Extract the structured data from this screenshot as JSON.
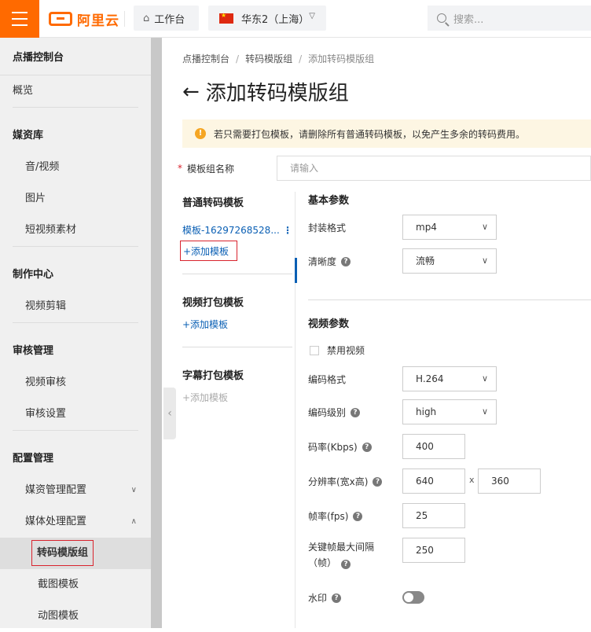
{
  "topbar": {
    "brand": "阿里云",
    "workspace": "工作台",
    "region": "华东2（上海）",
    "search_placeholder": "搜索..."
  },
  "sidebar": {
    "title": "点播控制台",
    "overview": "概览",
    "groups": [
      {
        "head": "媒资库",
        "items": [
          "音/视频",
          "图片",
          "短视频素材"
        ]
      },
      {
        "head": "制作中心",
        "items": [
          "视频剪辑"
        ]
      },
      {
        "head": "审核管理",
        "items": [
          "视频审核",
          "审核设置"
        ]
      },
      {
        "head": "配置管理",
        "items": [
          "媒资管理配置",
          "媒体处理配置",
          "转码模版组",
          "截图模板",
          "动图模板"
        ]
      }
    ]
  },
  "breadcrumb": [
    "点播控制台",
    "转码模版组",
    "添加转码模版组"
  ],
  "page_title": "添加转码模版组",
  "notice": "若只需要打包模板，请删除所有普通转码模板，以免产生多余的转码费用。",
  "form": {
    "name_label": "模板组名称",
    "name_placeholder": "请输入"
  },
  "templates": {
    "normal_title": "普通转码模板",
    "normal_item": "模板-16297268528...",
    "add_label": "+添加模板",
    "video_pack_title": "视频打包模板",
    "subtitle_pack_title": "字幕打包模板"
  },
  "basic": {
    "title": "基本参数",
    "container_label": "封装格式",
    "container_value": "mp4",
    "definition_label": "清晰度",
    "definition_value": "流畅"
  },
  "video": {
    "title": "视频参数",
    "disable_label": "禁用视频",
    "codec_label": "编码格式",
    "codec_value": "H.264",
    "profile_label": "编码级别",
    "profile_value": "high",
    "bitrate_label": "码率(Kbps)",
    "bitrate_value": "400",
    "resolution_label": "分辨率(宽x高)",
    "width_value": "640",
    "height_value": "360",
    "times": "x",
    "fps_label": "帧率(fps)",
    "fps_value": "25",
    "gop_label": "关键帧最大间隔",
    "gop_label2": "（帧）",
    "gop_value": "250",
    "watermark_label": "水印"
  }
}
